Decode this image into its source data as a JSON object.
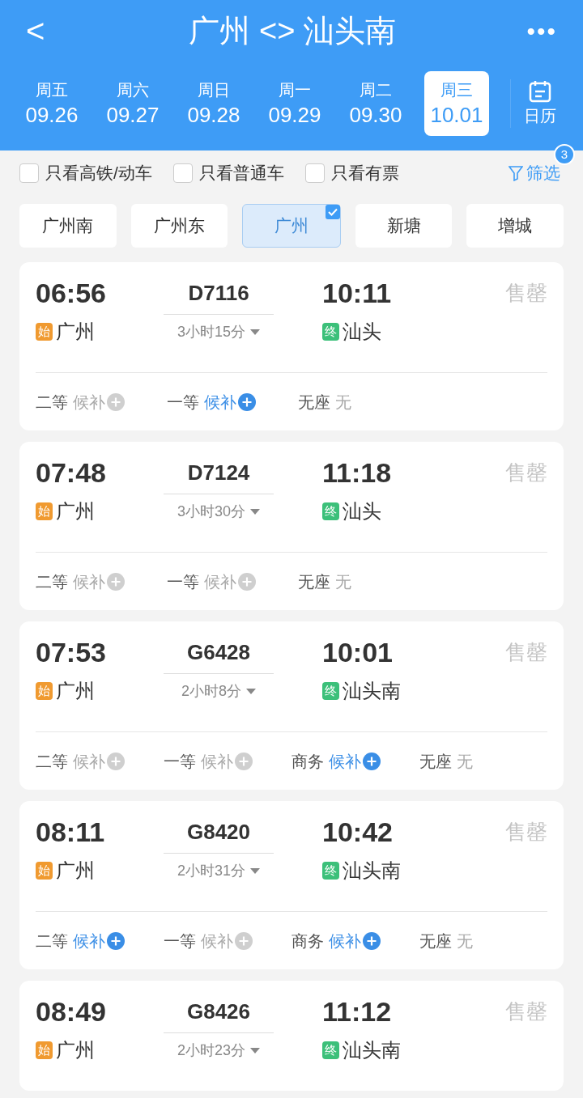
{
  "header": {
    "back": "<",
    "title": "广州 <> 汕头南",
    "more": "•••"
  },
  "dates": [
    {
      "weekday": "周五",
      "date": "09.26",
      "selected": false
    },
    {
      "weekday": "周六",
      "date": "09.27",
      "selected": false
    },
    {
      "weekday": "周日",
      "date": "09.28",
      "selected": false
    },
    {
      "weekday": "周一",
      "date": "09.29",
      "selected": false
    },
    {
      "weekday": "周二",
      "date": "09.30",
      "selected": false
    },
    {
      "weekday": "周三",
      "date": "10.01",
      "selected": true
    }
  ],
  "calendar": "日历",
  "filters": [
    {
      "label": "只看高铁/动车",
      "checked": false
    },
    {
      "label": "只看普通车",
      "checked": false
    },
    {
      "label": "只看有票",
      "checked": false
    }
  ],
  "filter_button": {
    "label": "筛选",
    "badge": "3"
  },
  "stations": [
    {
      "label": "广州南",
      "selected": false
    },
    {
      "label": "广州东",
      "selected": false
    },
    {
      "label": "广州",
      "selected": true
    },
    {
      "label": "新塘",
      "selected": false
    },
    {
      "label": "增城",
      "selected": false
    }
  ],
  "trains": [
    {
      "depart": "06:56",
      "number": "D7116",
      "arrive": "10:11",
      "status": "售罄",
      "start_badge": "始",
      "from": "广州",
      "duration": "3小时15分",
      "end_badge": "终",
      "to": "汕头",
      "seats": [
        {
          "class": "二等",
          "kind": "waitlist",
          "value": "候补",
          "available": false
        },
        {
          "class": "一等",
          "kind": "waitlist",
          "value": "候补",
          "available": true
        },
        {
          "class": "无座",
          "kind": "text",
          "value": "无",
          "available": false
        }
      ]
    },
    {
      "depart": "07:48",
      "number": "D7124",
      "arrive": "11:18",
      "status": "售罄",
      "start_badge": "始",
      "from": "广州",
      "duration": "3小时30分",
      "end_badge": "终",
      "to": "汕头",
      "seats": [
        {
          "class": "二等",
          "kind": "waitlist",
          "value": "候补",
          "available": false
        },
        {
          "class": "一等",
          "kind": "waitlist",
          "value": "候补",
          "available": false
        },
        {
          "class": "无座",
          "kind": "text",
          "value": "无",
          "available": false
        }
      ]
    },
    {
      "depart": "07:53",
      "number": "G6428",
      "arrive": "10:01",
      "status": "售罄",
      "start_badge": "始",
      "from": "广州",
      "duration": "2小时8分",
      "end_badge": "终",
      "to": "汕头南",
      "seats": [
        {
          "class": "二等",
          "kind": "waitlist",
          "value": "候补",
          "available": false
        },
        {
          "class": "一等",
          "kind": "waitlist",
          "value": "候补",
          "available": false
        },
        {
          "class": "商务",
          "kind": "waitlist",
          "value": "候补",
          "available": true
        },
        {
          "class": "无座",
          "kind": "text",
          "value": "无",
          "available": false
        }
      ]
    },
    {
      "depart": "08:11",
      "number": "G8420",
      "arrive": "10:42",
      "status": "售罄",
      "start_badge": "始",
      "from": "广州",
      "duration": "2小时31分",
      "end_badge": "终",
      "to": "汕头南",
      "seats": [
        {
          "class": "二等",
          "kind": "waitlist",
          "value": "候补",
          "available": true
        },
        {
          "class": "一等",
          "kind": "waitlist",
          "value": "候补",
          "available": false
        },
        {
          "class": "商务",
          "kind": "waitlist",
          "value": "候补",
          "available": true
        },
        {
          "class": "无座",
          "kind": "text",
          "value": "无",
          "available": false
        }
      ]
    },
    {
      "depart": "08:49",
      "number": "G8426",
      "arrive": "11:12",
      "status": "售罄",
      "start_badge": "始",
      "from": "广州",
      "duration": "2小时23分",
      "end_badge": "终",
      "to": "汕头南"
    }
  ]
}
